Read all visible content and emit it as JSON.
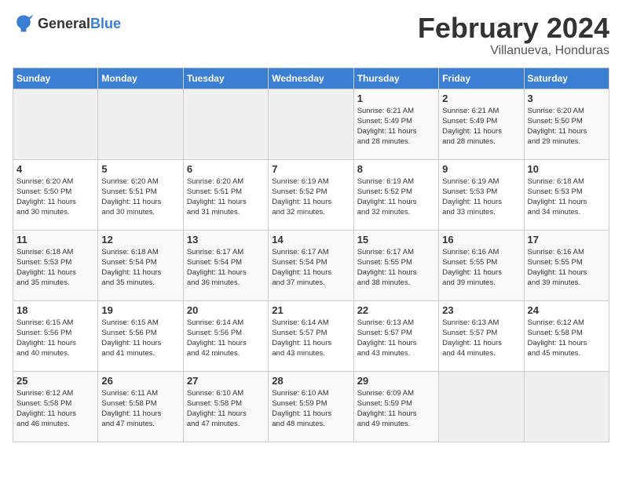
{
  "header": {
    "logo_general": "General",
    "logo_blue": "Blue",
    "month_title": "February 2024",
    "location": "Villanueva, Honduras"
  },
  "days_of_week": [
    "Sunday",
    "Monday",
    "Tuesday",
    "Wednesday",
    "Thursday",
    "Friday",
    "Saturday"
  ],
  "weeks": [
    [
      {
        "day": "",
        "info": ""
      },
      {
        "day": "",
        "info": ""
      },
      {
        "day": "",
        "info": ""
      },
      {
        "day": "",
        "info": ""
      },
      {
        "day": "1",
        "info": "Sunrise: 6:21 AM\nSunset: 5:49 PM\nDaylight: 11 hours\nand 28 minutes."
      },
      {
        "day": "2",
        "info": "Sunrise: 6:21 AM\nSunset: 5:49 PM\nDaylight: 11 hours\nand 28 minutes."
      },
      {
        "day": "3",
        "info": "Sunrise: 6:20 AM\nSunset: 5:50 PM\nDaylight: 11 hours\nand 29 minutes."
      }
    ],
    [
      {
        "day": "4",
        "info": "Sunrise: 6:20 AM\nSunset: 5:50 PM\nDaylight: 11 hours\nand 30 minutes."
      },
      {
        "day": "5",
        "info": "Sunrise: 6:20 AM\nSunset: 5:51 PM\nDaylight: 11 hours\nand 30 minutes."
      },
      {
        "day": "6",
        "info": "Sunrise: 6:20 AM\nSunset: 5:51 PM\nDaylight: 11 hours\nand 31 minutes."
      },
      {
        "day": "7",
        "info": "Sunrise: 6:19 AM\nSunset: 5:52 PM\nDaylight: 11 hours\nand 32 minutes."
      },
      {
        "day": "8",
        "info": "Sunrise: 6:19 AM\nSunset: 5:52 PM\nDaylight: 11 hours\nand 32 minutes."
      },
      {
        "day": "9",
        "info": "Sunrise: 6:19 AM\nSunset: 5:53 PM\nDaylight: 11 hours\nand 33 minutes."
      },
      {
        "day": "10",
        "info": "Sunrise: 6:18 AM\nSunset: 5:53 PM\nDaylight: 11 hours\nand 34 minutes."
      }
    ],
    [
      {
        "day": "11",
        "info": "Sunrise: 6:18 AM\nSunset: 5:53 PM\nDaylight: 11 hours\nand 35 minutes."
      },
      {
        "day": "12",
        "info": "Sunrise: 6:18 AM\nSunset: 5:54 PM\nDaylight: 11 hours\nand 35 minutes."
      },
      {
        "day": "13",
        "info": "Sunrise: 6:17 AM\nSunset: 5:54 PM\nDaylight: 11 hours\nand 36 minutes."
      },
      {
        "day": "14",
        "info": "Sunrise: 6:17 AM\nSunset: 5:54 PM\nDaylight: 11 hours\nand 37 minutes."
      },
      {
        "day": "15",
        "info": "Sunrise: 6:17 AM\nSunset: 5:55 PM\nDaylight: 11 hours\nand 38 minutes."
      },
      {
        "day": "16",
        "info": "Sunrise: 6:16 AM\nSunset: 5:55 PM\nDaylight: 11 hours\nand 39 minutes."
      },
      {
        "day": "17",
        "info": "Sunrise: 6:16 AM\nSunset: 5:55 PM\nDaylight: 11 hours\nand 39 minutes."
      }
    ],
    [
      {
        "day": "18",
        "info": "Sunrise: 6:15 AM\nSunset: 5:56 PM\nDaylight: 11 hours\nand 40 minutes."
      },
      {
        "day": "19",
        "info": "Sunrise: 6:15 AM\nSunset: 5:56 PM\nDaylight: 11 hours\nand 41 minutes."
      },
      {
        "day": "20",
        "info": "Sunrise: 6:14 AM\nSunset: 5:56 PM\nDaylight: 11 hours\nand 42 minutes."
      },
      {
        "day": "21",
        "info": "Sunrise: 6:14 AM\nSunset: 5:57 PM\nDaylight: 11 hours\nand 43 minutes."
      },
      {
        "day": "22",
        "info": "Sunrise: 6:13 AM\nSunset: 5:57 PM\nDaylight: 11 hours\nand 43 minutes."
      },
      {
        "day": "23",
        "info": "Sunrise: 6:13 AM\nSunset: 5:57 PM\nDaylight: 11 hours\nand 44 minutes."
      },
      {
        "day": "24",
        "info": "Sunrise: 6:12 AM\nSunset: 5:58 PM\nDaylight: 11 hours\nand 45 minutes."
      }
    ],
    [
      {
        "day": "25",
        "info": "Sunrise: 6:12 AM\nSunset: 5:58 PM\nDaylight: 11 hours\nand 46 minutes."
      },
      {
        "day": "26",
        "info": "Sunrise: 6:11 AM\nSunset: 5:58 PM\nDaylight: 11 hours\nand 47 minutes."
      },
      {
        "day": "27",
        "info": "Sunrise: 6:10 AM\nSunset: 5:58 PM\nDaylight: 11 hours\nand 47 minutes."
      },
      {
        "day": "28",
        "info": "Sunrise: 6:10 AM\nSunset: 5:59 PM\nDaylight: 11 hours\nand 48 minutes."
      },
      {
        "day": "29",
        "info": "Sunrise: 6:09 AM\nSunset: 5:59 PM\nDaylight: 11 hours\nand 49 minutes."
      },
      {
        "day": "",
        "info": ""
      },
      {
        "day": "",
        "info": ""
      }
    ]
  ]
}
